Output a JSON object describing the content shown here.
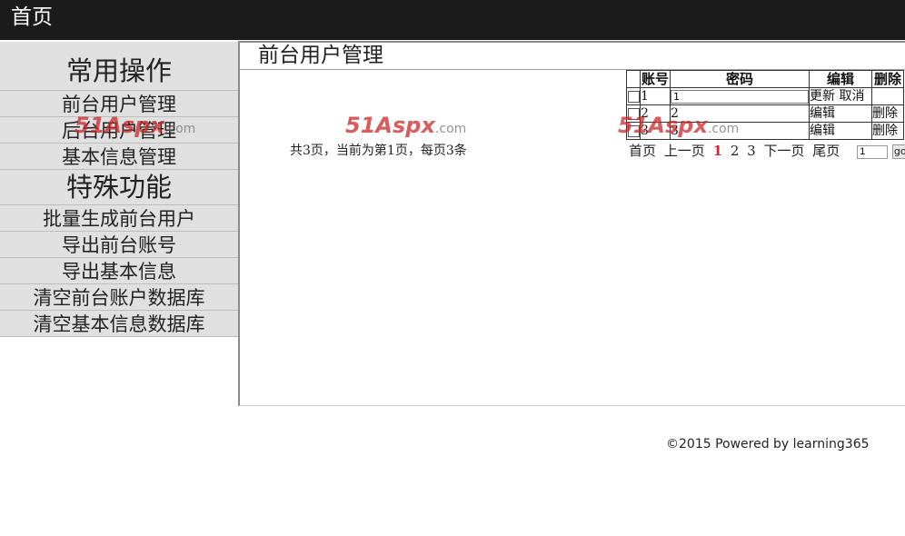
{
  "header": {
    "home_label": "首页"
  },
  "sidebar": {
    "group1_title": "常用操作",
    "group1_items": [
      "前台用户管理",
      "后台用户管理",
      "基本信息管理"
    ],
    "group2_title": "特殊功能",
    "group2_items": [
      "批量生成前台用户",
      "导出前台账号",
      "导出基本信息",
      "清空前台账户数据库",
      "清空基本信息数据库"
    ]
  },
  "main": {
    "title": "前台用户管理",
    "table": {
      "headers": [
        "账号",
        "密码",
        "编辑",
        "删除"
      ],
      "rows": [
        {
          "account": "1",
          "password": "1",
          "edit": "更新",
          "cancel": "取消",
          "delete": ""
        },
        {
          "account": "2",
          "password": "2",
          "edit": "编辑",
          "delete": "删除"
        },
        {
          "account": "3",
          "password": "3",
          "edit": "编辑",
          "delete": "删除"
        }
      ]
    },
    "summary": "共3页，当前为第1页，每页3条",
    "pager": {
      "first": "首页",
      "prev": "上一页",
      "pages": [
        "1",
        "2",
        "3"
      ],
      "current": "1",
      "next": "下一页",
      "last": "尾页",
      "goto_value": "1",
      "go_label": "go"
    }
  },
  "watermark": {
    "brand": "51Aspx",
    "domain": ".com"
  },
  "footer": {
    "text": "©2015 Powered by learning365"
  }
}
